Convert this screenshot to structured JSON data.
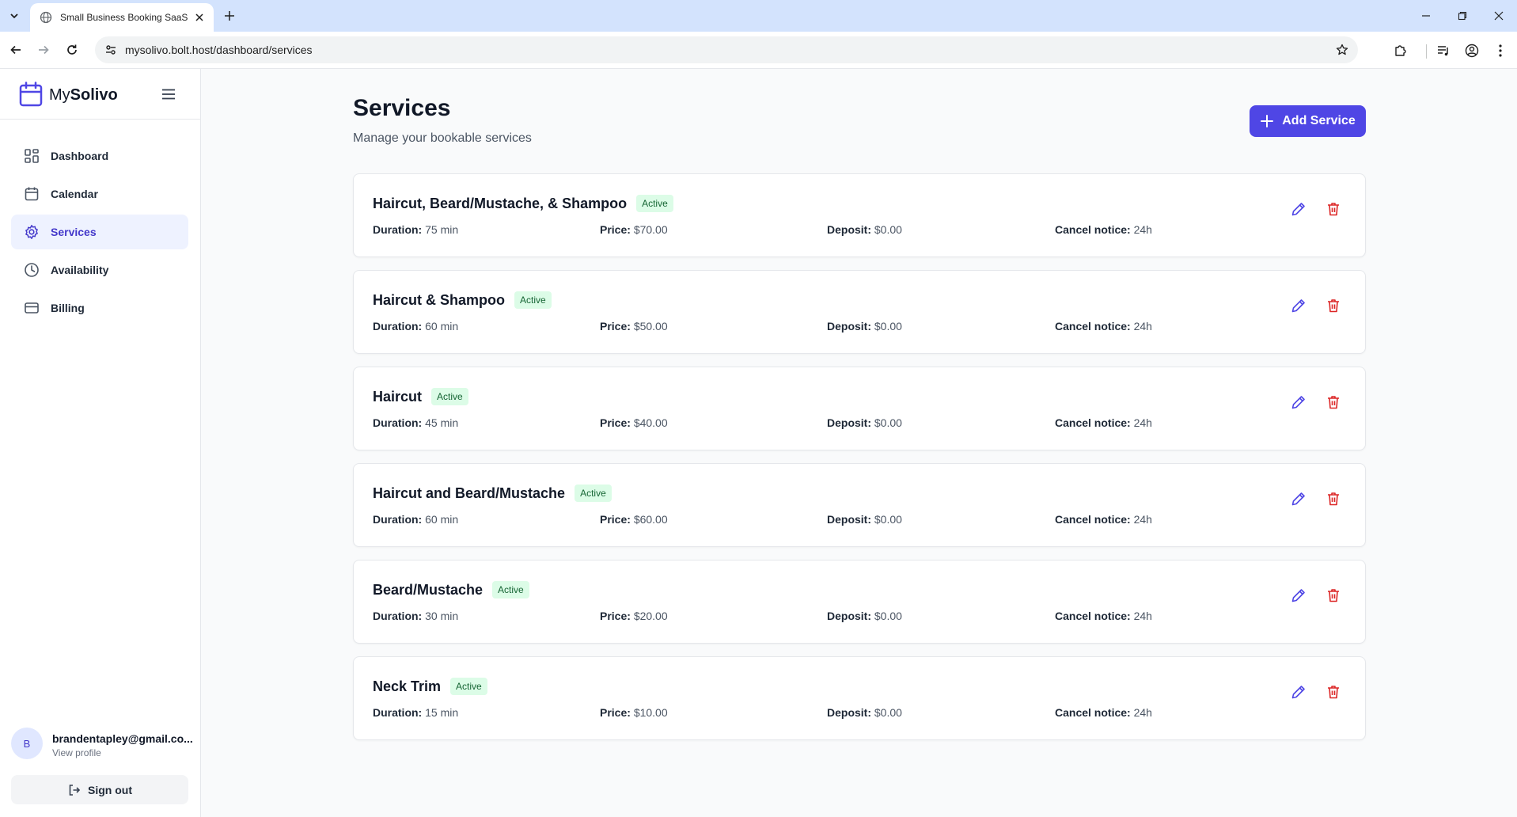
{
  "browser": {
    "tab_title": "Small Business Booking SaaS",
    "url": "mysolivo.bolt.host/dashboard/services"
  },
  "brand": {
    "prefix": "My",
    "name": "Solivo"
  },
  "nav": {
    "items": [
      {
        "label": "Dashboard",
        "icon": "dashboard-icon",
        "active": false
      },
      {
        "label": "Calendar",
        "icon": "calendar-icon",
        "active": false
      },
      {
        "label": "Services",
        "icon": "gear-icon",
        "active": true
      },
      {
        "label": "Availability",
        "icon": "clock-icon",
        "active": false
      },
      {
        "label": "Billing",
        "icon": "credit-card-icon",
        "active": false
      }
    ]
  },
  "user": {
    "initial": "B",
    "email": "brandentapley@gmail.co...",
    "link": "View profile"
  },
  "signout_label": "Sign out",
  "page": {
    "title": "Services",
    "subtitle": "Manage your bookable services",
    "add_label": "Add Service"
  },
  "labels": {
    "duration": "Duration:",
    "price": "Price:",
    "deposit": "Deposit:",
    "cancel": "Cancel notice:"
  },
  "services": [
    {
      "name": "Haircut, Beard/Mustache, & Shampoo",
      "status": "Active",
      "duration": "75 min",
      "price": "$70.00",
      "deposit": "$0.00",
      "cancel_notice": "24h"
    },
    {
      "name": "Haircut & Shampoo",
      "status": "Active",
      "duration": "60 min",
      "price": "$50.00",
      "deposit": "$0.00",
      "cancel_notice": "24h"
    },
    {
      "name": "Haircut",
      "status": "Active",
      "duration": "45 min",
      "price": "$40.00",
      "deposit": "$0.00",
      "cancel_notice": "24h"
    },
    {
      "name": "Haircut and Beard/Mustache",
      "status": "Active",
      "duration": "60 min",
      "price": "$60.00",
      "deposit": "$0.00",
      "cancel_notice": "24h"
    },
    {
      "name": "Beard/Mustache",
      "status": "Active",
      "duration": "30 min",
      "price": "$20.00",
      "deposit": "$0.00",
      "cancel_notice": "24h"
    },
    {
      "name": "Neck Trim",
      "status": "Active",
      "duration": "15 min",
      "price": "$10.00",
      "deposit": "$0.00",
      "cancel_notice": "24h"
    }
  ],
  "colors": {
    "accent": "#4f46e5",
    "active_nav_bg": "#eef2ff",
    "badge_bg": "#dcfce7",
    "badge_text": "#166534",
    "delete": "#dc2626"
  }
}
